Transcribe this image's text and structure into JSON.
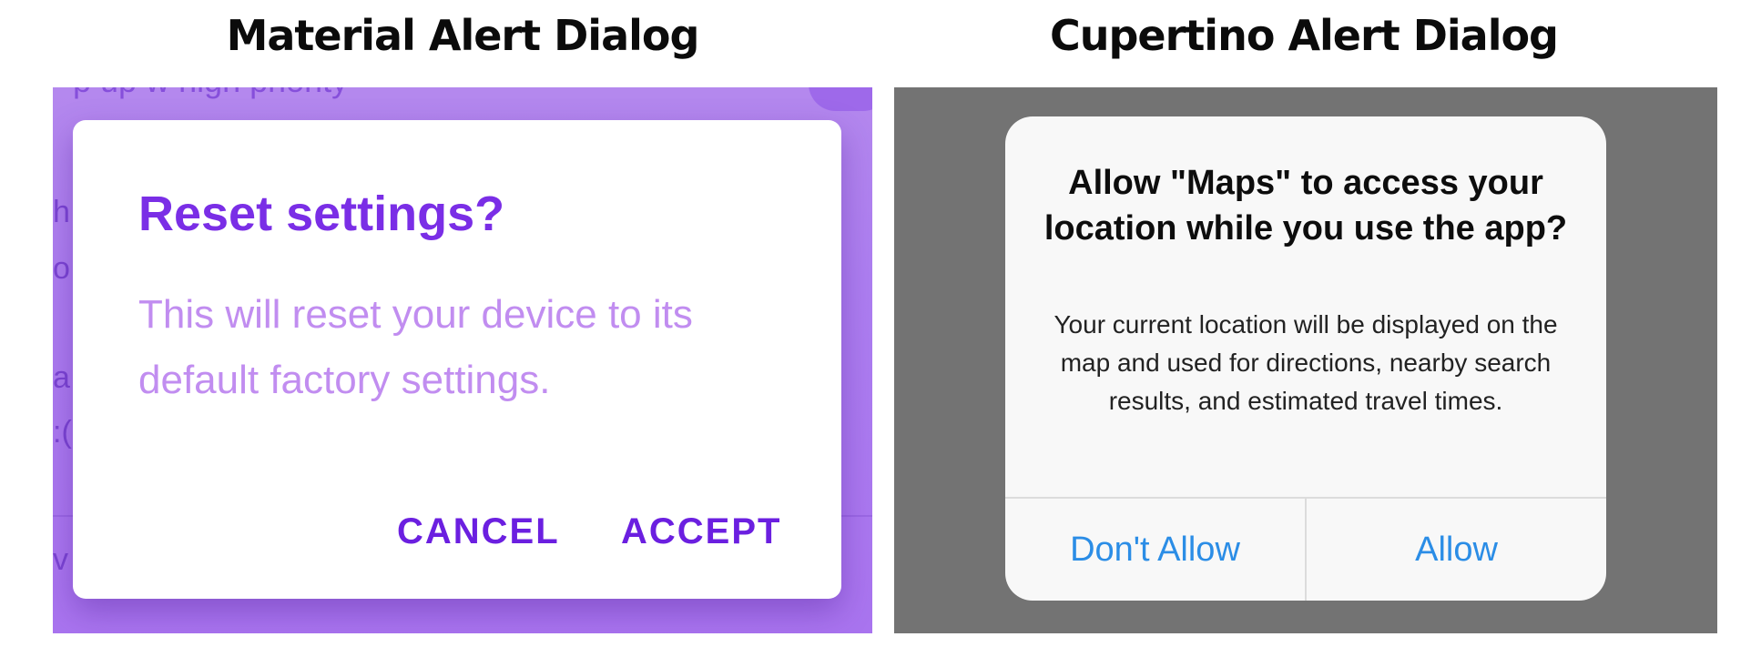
{
  "captions": {
    "material": "Material Alert Dialog",
    "cupertino": "Cupertino Alert Dialog"
  },
  "material_dialog": {
    "title": "Reset settings?",
    "body": "This will reset your device to its default factory settings.",
    "buttons": {
      "cancel": "CANCEL",
      "accept": "ACCEPT"
    },
    "colors": {
      "title": "#7a2ee6",
      "body": "#c18df0",
      "buttons": "#6b1fe0",
      "backdrop": "#ad7ef0"
    }
  },
  "cupertino_dialog": {
    "title": "Allow \"Maps\" to access your location while you use the app?",
    "message": "Your current location will be displayed on the map and used for directions, nearby search results, and estimated travel times.",
    "buttons": {
      "deny": "Don't Allow",
      "allow": "Allow"
    },
    "colors": {
      "buttons": "#2b8de6",
      "backdrop": "#737373",
      "surface": "#f8f8f8"
    }
  }
}
